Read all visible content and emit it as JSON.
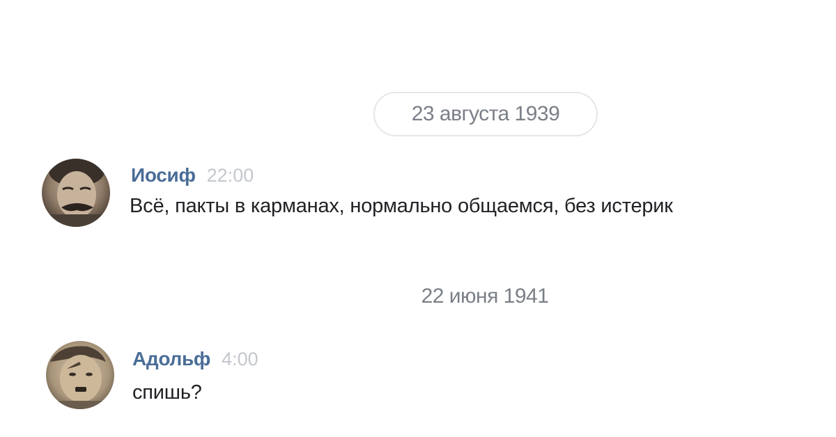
{
  "chat": {
    "separators": [
      {
        "label": "23 августа 1939"
      },
      {
        "label": "22 июня 1941"
      }
    ],
    "messages": [
      {
        "author": "Иосиф",
        "time": "22:00",
        "text": "Всё, пакты в карманах, нормально общаемся, без истерик",
        "avatar_icon": "user-avatar-photo"
      },
      {
        "author": "Адольф",
        "time": "4:00",
        "text": "спишь?",
        "avatar_icon": "user-avatar-photo"
      }
    ]
  },
  "colors": {
    "author": "#4a6d97",
    "timestamp": "#c3c7cd",
    "date_label": "#7a7f87",
    "message_text": "#1f2124",
    "pill_border": "#e3e6ea"
  }
}
